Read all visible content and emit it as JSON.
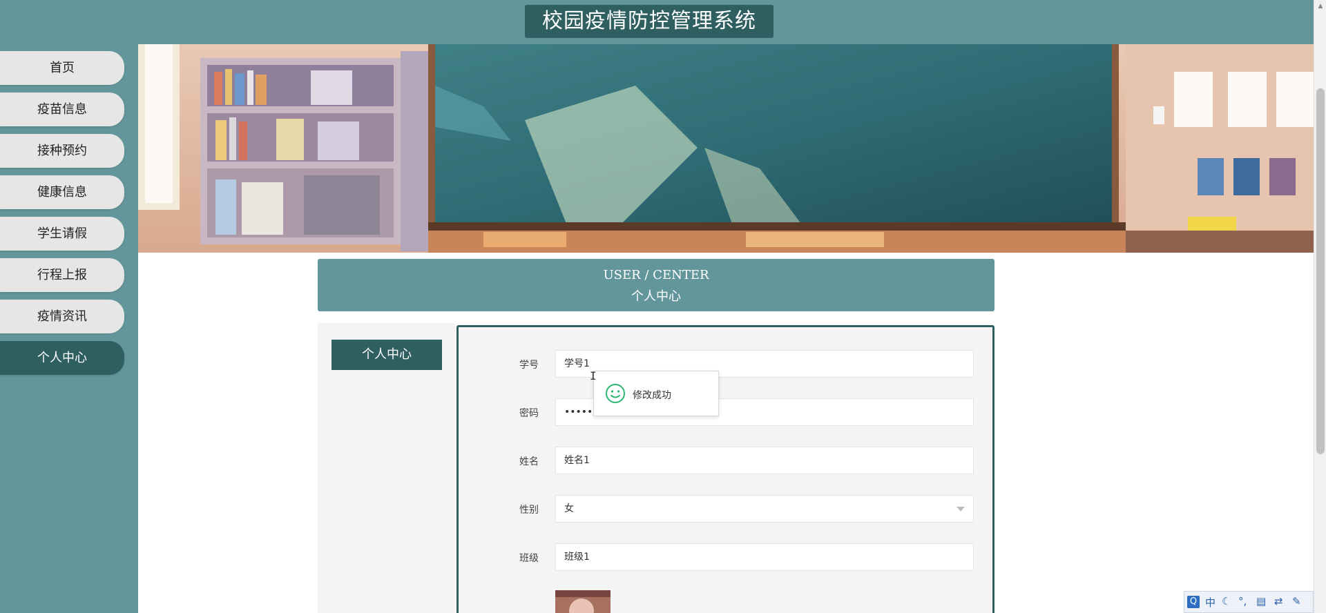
{
  "app": {
    "title": "校园疫情防控管理系统"
  },
  "sidebar": {
    "items": [
      {
        "label": "首页"
      },
      {
        "label": "疫苗信息"
      },
      {
        "label": "接种预约"
      },
      {
        "label": "健康信息"
      },
      {
        "label": "学生请假"
      },
      {
        "label": "行程上报"
      },
      {
        "label": "疫情资讯"
      },
      {
        "label": "个人中心",
        "active": true
      }
    ]
  },
  "center": {
    "title_en": "USER / CENTER",
    "title_cn": "个人中心",
    "tab_label": "个人中心"
  },
  "form": {
    "fields": [
      {
        "label": "学号",
        "value": "学号1"
      },
      {
        "label": "密码",
        "value": "••••••"
      },
      {
        "label": "姓名",
        "value": "姓名1"
      },
      {
        "label": "性别",
        "value": "女"
      },
      {
        "label": "班级",
        "value": "班级1"
      }
    ]
  },
  "toast": {
    "message": "修改成功",
    "icon": "smile-icon"
  },
  "ime": {
    "mode": "中",
    "logo": "Q"
  },
  "colors": {
    "primary": "#62969a",
    "dark": "#2f5f60",
    "panel": "#f4f4f4",
    "toast_icon": "#2bb673"
  }
}
